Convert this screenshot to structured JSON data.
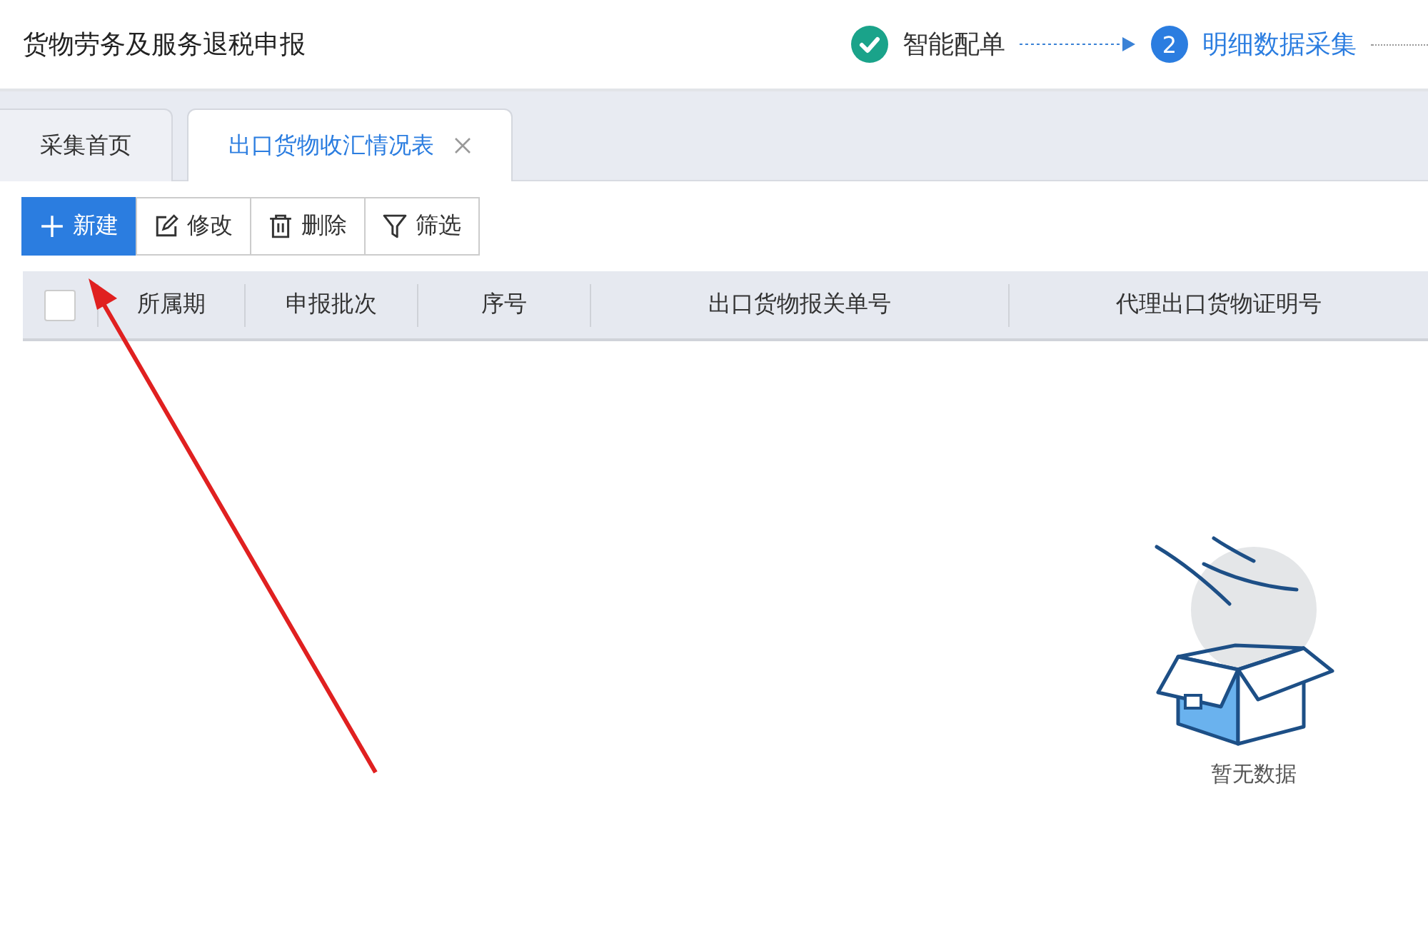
{
  "app_title": "货物劳务及服务退税申报",
  "steps": [
    {
      "label": "智能配单",
      "done": true,
      "selected": false
    },
    {
      "number": "2",
      "label": "明细数据采集",
      "done": false,
      "selected": true
    }
  ],
  "tabs": [
    {
      "label": "采集首页",
      "selected": false,
      "closable": false
    },
    {
      "label": "出口货物收汇情况表",
      "selected": true,
      "closable": true
    }
  ],
  "toolbar": [
    {
      "label": "新建",
      "kind": "add",
      "primary": true
    },
    {
      "label": "修改",
      "kind": "edit",
      "primary": false
    },
    {
      "label": "删除",
      "kind": "delete",
      "primary": false
    },
    {
      "label": "筛选",
      "kind": "filter",
      "primary": false
    }
  ],
  "table": {
    "select_all": {
      "checked": false
    },
    "columns": [
      "所属期",
      "申报批次",
      "序号",
      "出口货物报关单号",
      "代理出口货物证明号"
    ]
  },
  "empty_state": {
    "text": "暂无数据"
  }
}
